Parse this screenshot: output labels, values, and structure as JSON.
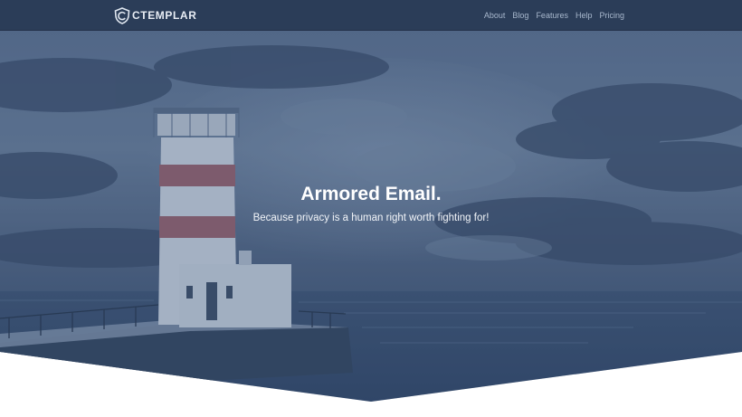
{
  "brand": {
    "name": "CTEMPLAR",
    "icon": "shield-logo-icon"
  },
  "nav": {
    "items": [
      {
        "label": "About"
      },
      {
        "label": "Blog"
      },
      {
        "label": "Features"
      },
      {
        "label": "Help"
      },
      {
        "label": "Pricing"
      }
    ]
  },
  "hero": {
    "title": "Armored Email.",
    "subtitle": "Because privacy is a human right worth fighting for!",
    "background": "lighthouse-sea-photo"
  },
  "colors": {
    "navbar": "#2b3d58",
    "hero_overlay": "#2d4368",
    "nav_link": "#a8b8cd",
    "page_background": "#ffffff"
  }
}
